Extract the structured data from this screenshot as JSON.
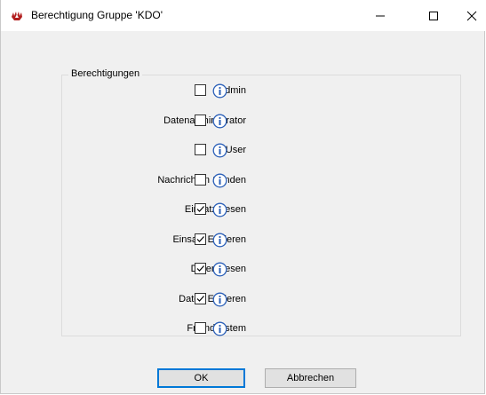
{
  "window": {
    "title": "Berechtigung Gruppe 'KDO'",
    "controls": {
      "minimize": "minimize-icon",
      "maximize": "maximize-icon",
      "close": "close-icon"
    }
  },
  "group": {
    "label": "Berechtigungen",
    "permissions": [
      {
        "label": "Admin",
        "checked": false
      },
      {
        "label": "Datenadministrator",
        "checked": false
      },
      {
        "label": "User",
        "checked": false
      },
      {
        "label": "Nachrichten Senden",
        "checked": false
      },
      {
        "label": "Einsatz Lesen",
        "checked": true
      },
      {
        "label": "Einsatz Editieren",
        "checked": true
      },
      {
        "label": "Daten Lesen",
        "checked": true
      },
      {
        "label": "Daten Editieren",
        "checked": true
      },
      {
        "label": "Fremdsystem",
        "checked": false
      }
    ]
  },
  "buttons": {
    "ok": "OK",
    "cancel": "Abbrechen"
  },
  "colors": {
    "accent": "#0078d7",
    "info": "#2a5fb8"
  }
}
